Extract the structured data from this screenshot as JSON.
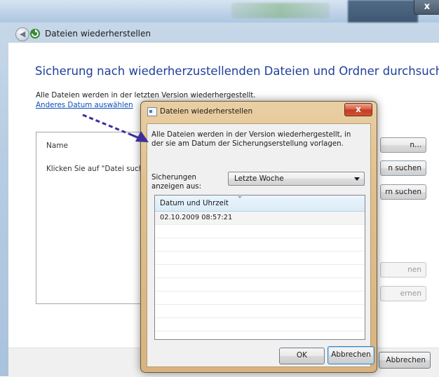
{
  "main_window": {
    "title": "Dateien wiederherstellen",
    "close_label": "x",
    "back_glyph": "◀",
    "heading": "Sicherung nach wiederherzustellenden Dateien und Ordner durchsuchen",
    "info": "Alle Dateien werden in der letzten Version wiederhergestellt.",
    "link": "Anderes Datum auswählen",
    "list_column_name": "Name",
    "list_hint": "Klicken Sie auf \"Datei such",
    "side_buttons": [
      "n...",
      "n suchen",
      "rn suchen",
      "nen",
      "ernen"
    ],
    "cancel_button": "Abbrechen"
  },
  "dialog": {
    "title": "Dateien wiederherstellen",
    "close_label": "x",
    "info": "Alle Dateien werden in der Version wiederhergestellt, in der sie am Datum der Sicherungserstellung vorlagen.",
    "label": "Sicherungen anzeigen aus:",
    "select_value": "Letzte Woche",
    "table_header": "Datum und Uhrzeit",
    "rows": [
      "02.10.2009 08:57:21",
      "",
      "",
      "",
      "",
      "",
      "",
      "",
      "",
      ""
    ],
    "ok_button": "OK",
    "cancel_button": "Abbrechen"
  },
  "colors": {
    "heading": "#1f3f9a",
    "link": "#0b4fb6",
    "dialog_frame": "#e1c08e",
    "close_red": "#c4391e",
    "arrow": "#3b2e9c"
  }
}
